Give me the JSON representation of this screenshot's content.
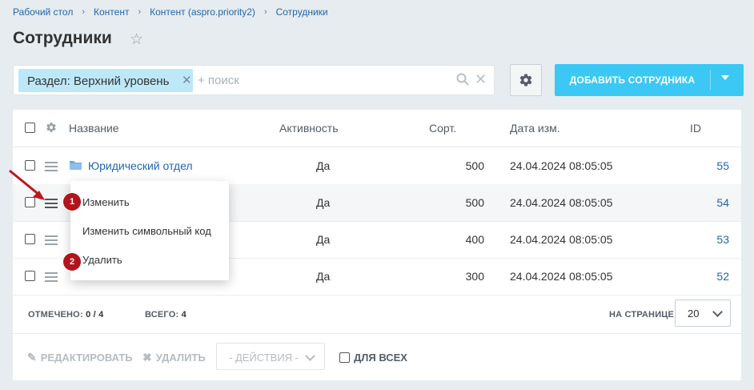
{
  "breadcrumb": {
    "items": [
      "Рабочий стол",
      "Контент",
      "Контент (aspro.priority2)",
      "Сотрудники"
    ],
    "separator": "›"
  },
  "page": {
    "title": "Сотрудники"
  },
  "filter": {
    "tag_label": "Раздел: Верхний уровень",
    "placeholder": "+ поиск"
  },
  "toolbar": {
    "add_label": "ДОБАВИТЬ СОТРУДНИКА"
  },
  "table": {
    "columns": {
      "name": "Название",
      "active": "Активность",
      "sort": "Сорт.",
      "date": "Дата изм.",
      "id": "ID"
    },
    "rows": [
      {
        "name": "Юридический отдел",
        "active": "Да",
        "sort": "500",
        "date": "24.04.2024 08:05:05",
        "id": "55"
      },
      {
        "name": "",
        "active": "Да",
        "sort": "500",
        "date": "24.04.2024 08:05:05",
        "id": "54"
      },
      {
        "name": "",
        "active": "Да",
        "sort": "400",
        "date": "24.04.2024 08:05:05",
        "id": "53"
      },
      {
        "name": "",
        "active": "Да",
        "sort": "300",
        "date": "24.04.2024 08:05:05",
        "id": "52"
      }
    ]
  },
  "footer": {
    "selected_label": "ОТМЕЧЕНО:",
    "selected_value": "0 / 4",
    "total_label": "ВСЕГО:",
    "total_value": "4",
    "per_page_label": "НА СТРАНИЦЕ:",
    "per_page_value": "20"
  },
  "actions": {
    "edit": "РЕДАКТИРОВАТЬ",
    "delete": "УДАЛИТЬ",
    "select": "- ДЕЙСТВИЯ -",
    "for_all": "ДЛЯ ВСЕХ"
  },
  "context_menu": {
    "items": [
      "Изменить",
      "Изменить символьный код",
      "Удалить"
    ],
    "markers": [
      "1",
      "2"
    ]
  },
  "colors": {
    "accent": "#3bc8f5",
    "link": "#2067b0",
    "marker": "#b3141b",
    "tag": "#bde8f7"
  }
}
